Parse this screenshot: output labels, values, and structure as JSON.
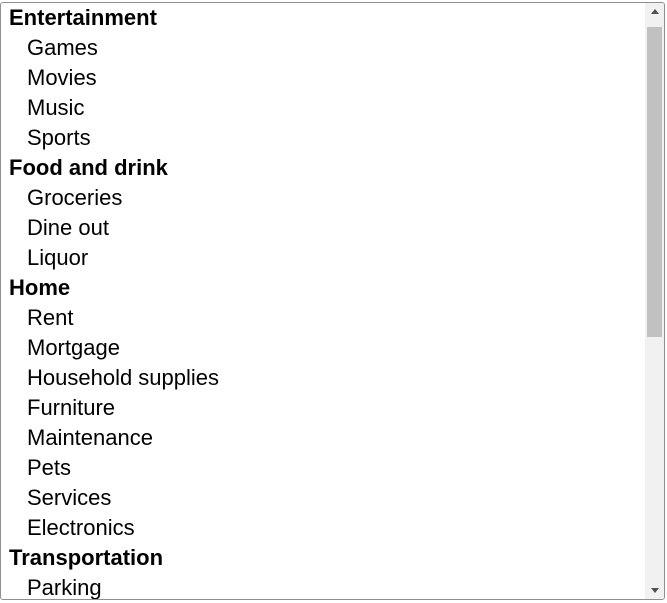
{
  "listbox": {
    "groups": [
      {
        "label": "Entertainment",
        "options": [
          "Games",
          "Movies",
          "Music",
          "Sports"
        ]
      },
      {
        "label": "Food and drink",
        "options": [
          "Groceries",
          "Dine out",
          "Liquor"
        ]
      },
      {
        "label": "Home",
        "options": [
          "Rent",
          "Mortgage",
          "Household supplies",
          "Furniture",
          "Maintenance",
          "Pets",
          "Services",
          "Electronics"
        ]
      },
      {
        "label": "Transportation",
        "options": [
          "Parking"
        ]
      }
    ]
  },
  "scrollbar": {
    "up_icon": "triangle-up",
    "down_icon": "triangle-down",
    "scroll_position_fraction": 0.0
  }
}
